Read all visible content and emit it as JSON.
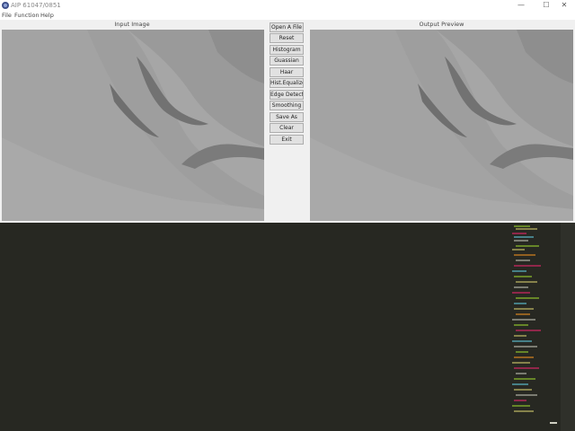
{
  "window": {
    "title": "AIP 61047/0851",
    "controls": {
      "minimize": "—",
      "maximize": "☐",
      "close": "✕"
    }
  },
  "menu": [
    "File",
    "Function",
    "Help"
  ],
  "panels": {
    "input_label": "Input Image",
    "output_label": "Output Preview"
  },
  "buttons": [
    "Open A File",
    "Reset",
    "Histogram",
    "Guassian",
    "Haar",
    "Hist.Equalize",
    "Edge Detect",
    "Smoothing",
    "Save As",
    "Clear",
    "Exit"
  ],
  "colors": {
    "app_background": "#f0f0f0",
    "terminal_background": "#272822",
    "button_face": "#e1e1e1",
    "image_gray": "#a9a9a9"
  }
}
